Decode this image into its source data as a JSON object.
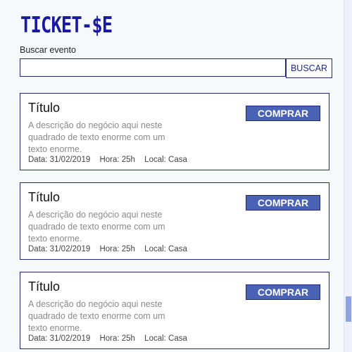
{
  "app": {
    "logo": "TICKET-$E"
  },
  "search": {
    "label": "Buscar evento",
    "value": "",
    "placeholder": "",
    "button_label": "BUSCAR"
  },
  "events": [
    {
      "title": "Título",
      "description": "A descrição do negócio aqui neste quadrado de texto enorme com um texto enorme.",
      "date": "Data: 31/02/2019",
      "time": "Hora: 25h",
      "location": "Local: Casa",
      "buy_label": "COMPRAR"
    },
    {
      "title": "Título",
      "description": "A descrição do negócio aqui neste quadrado de texto enorme com um texto enorme.",
      "date": "Data: 31/02/2019",
      "time": "Hora: 25h",
      "location": "Local: Casa",
      "buy_label": "COMPRAR"
    },
    {
      "title": "Título",
      "description": "A descrição do negócio aqui neste quadrado de texto enorme com um texto enorme.",
      "date": "Data: 31/02/2019",
      "time": "Hora: 25h",
      "location": "Local: Casa",
      "buy_label": "COMPRAR"
    }
  ],
  "colors": {
    "brand": "#1a1a9c",
    "border": "#1f2a7a",
    "button": "#4a62b3",
    "background": "#f6f9fc",
    "muted_text": "#8a8a8a"
  }
}
